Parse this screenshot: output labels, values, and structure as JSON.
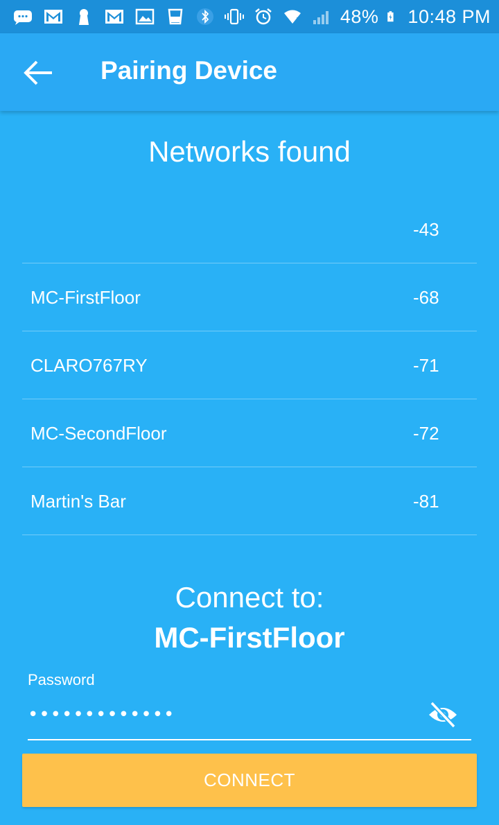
{
  "status_bar": {
    "battery": "48%",
    "time": "10:48 PM",
    "icons": [
      "messages-icon",
      "gmail-icon",
      "keyhole-icon",
      "gmail-icon",
      "gallery-icon",
      "cup-icon",
      "bluetooth-icon",
      "vibrate-icon",
      "alarm-icon",
      "wifi-icon",
      "cell-signal-icon",
      "battery-charging-icon"
    ]
  },
  "app_bar": {
    "title": "Pairing Device",
    "back_icon": "arrow-left-icon"
  },
  "networks": {
    "title": "Networks found",
    "items": [
      {
        "name": "",
        "signal": "-43"
      },
      {
        "name": "MC-FirstFloor",
        "signal": "-68"
      },
      {
        "name": "CLARO767RY",
        "signal": "-71"
      },
      {
        "name": "MC-SecondFloor",
        "signal": "-72"
      },
      {
        "name": "Martin's Bar",
        "signal": "-81"
      }
    ]
  },
  "connect": {
    "label": "Connect to:",
    "target": "MC-FirstFloor",
    "password_label": "Password",
    "password_value": "•••••••••••••",
    "visibility_icon": "eye-off-icon",
    "button_label": "CONNECT"
  },
  "colors": {
    "background": "#29b1f6",
    "status_bar": "#1c8fd9",
    "app_bar": "#2aa9f4",
    "button": "#fec14b"
  }
}
